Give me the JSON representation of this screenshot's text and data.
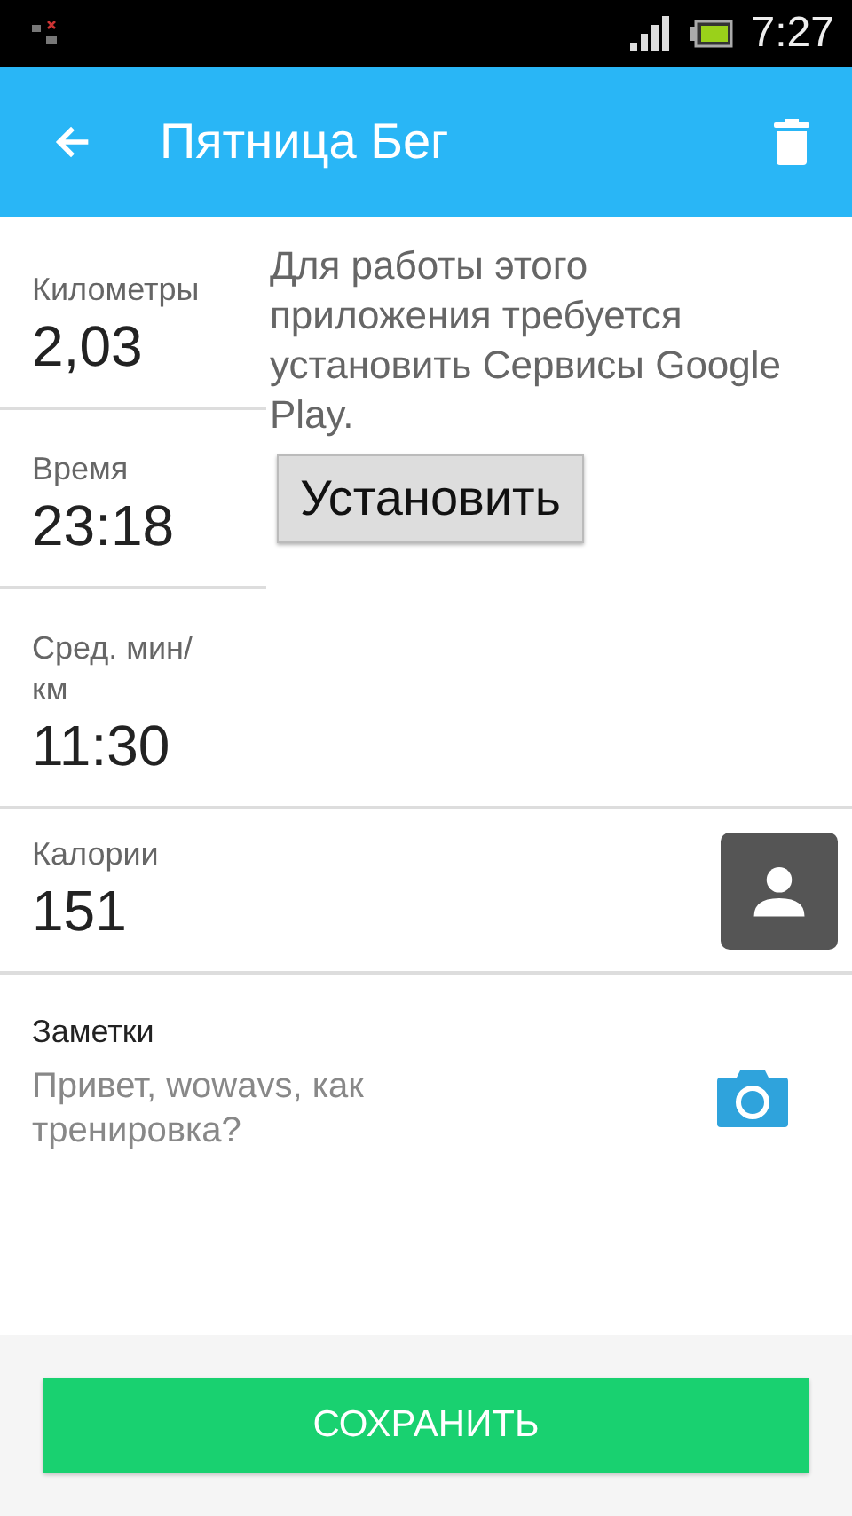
{
  "status_bar": {
    "time": "7:27"
  },
  "app_bar": {
    "title": "Пятница Бег"
  },
  "stats": [
    {
      "label": "Километры",
      "value": "2,03"
    },
    {
      "label": "Время",
      "value": "23:18"
    },
    {
      "label": "Сред. мин/км",
      "value": "11:30"
    }
  ],
  "play_services": {
    "message": "Для работы этого приложения требуется установить Сервисы Google Play.",
    "button": "Установить"
  },
  "calories": {
    "label": "Калории",
    "value": "151"
  },
  "notes": {
    "label": "Заметки",
    "placeholder": "Привет, wowavs, как тренировка?"
  },
  "save_button": "СОХРАНИТЬ"
}
